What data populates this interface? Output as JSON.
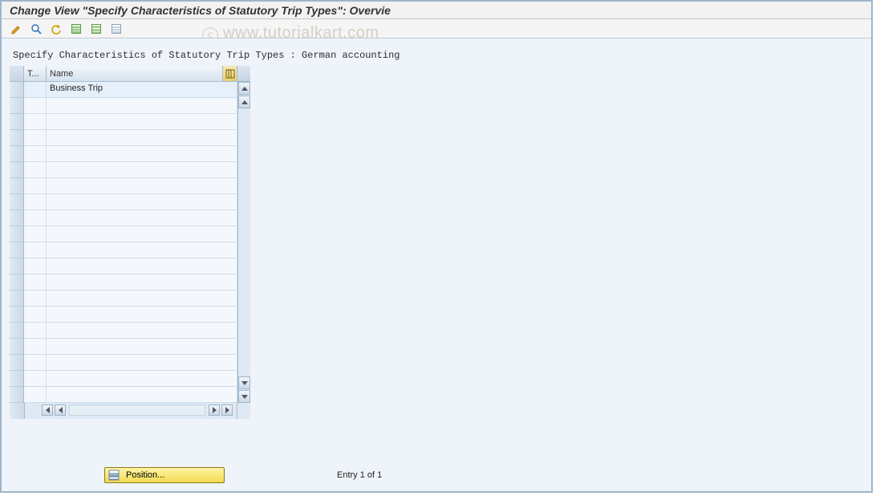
{
  "title": "Change View \"Specify Characteristics of Statutory Trip Types\": Overvie",
  "watermark": "© www.tutorialkart.com",
  "toolbar_hints": {
    "edit": "Display/Change",
    "details": "Details",
    "undo": "Undo",
    "select_all": "Select All",
    "select_block": "Select Block",
    "deselect_all": "Deselect All"
  },
  "subtitle": "Specify Characteristics of Statutory Trip Types : German accounting",
  "grid": {
    "columns": {
      "col1": "T...",
      "col2": "Name"
    },
    "rows": [
      {
        "t": "",
        "name": "Business Trip"
      },
      {
        "t": "",
        "name": ""
      },
      {
        "t": "",
        "name": ""
      },
      {
        "t": "",
        "name": ""
      },
      {
        "t": "",
        "name": ""
      },
      {
        "t": "",
        "name": ""
      },
      {
        "t": "",
        "name": ""
      },
      {
        "t": "",
        "name": ""
      },
      {
        "t": "",
        "name": ""
      },
      {
        "t": "",
        "name": ""
      },
      {
        "t": "",
        "name": ""
      },
      {
        "t": "",
        "name": ""
      },
      {
        "t": "",
        "name": ""
      },
      {
        "t": "",
        "name": ""
      },
      {
        "t": "",
        "name": ""
      },
      {
        "t": "",
        "name": ""
      },
      {
        "t": "",
        "name": ""
      },
      {
        "t": "",
        "name": ""
      },
      {
        "t": "",
        "name": ""
      },
      {
        "t": "",
        "name": ""
      }
    ]
  },
  "buttons": {
    "position": "Position..."
  },
  "status": {
    "entry": "Entry 1 of 1"
  }
}
